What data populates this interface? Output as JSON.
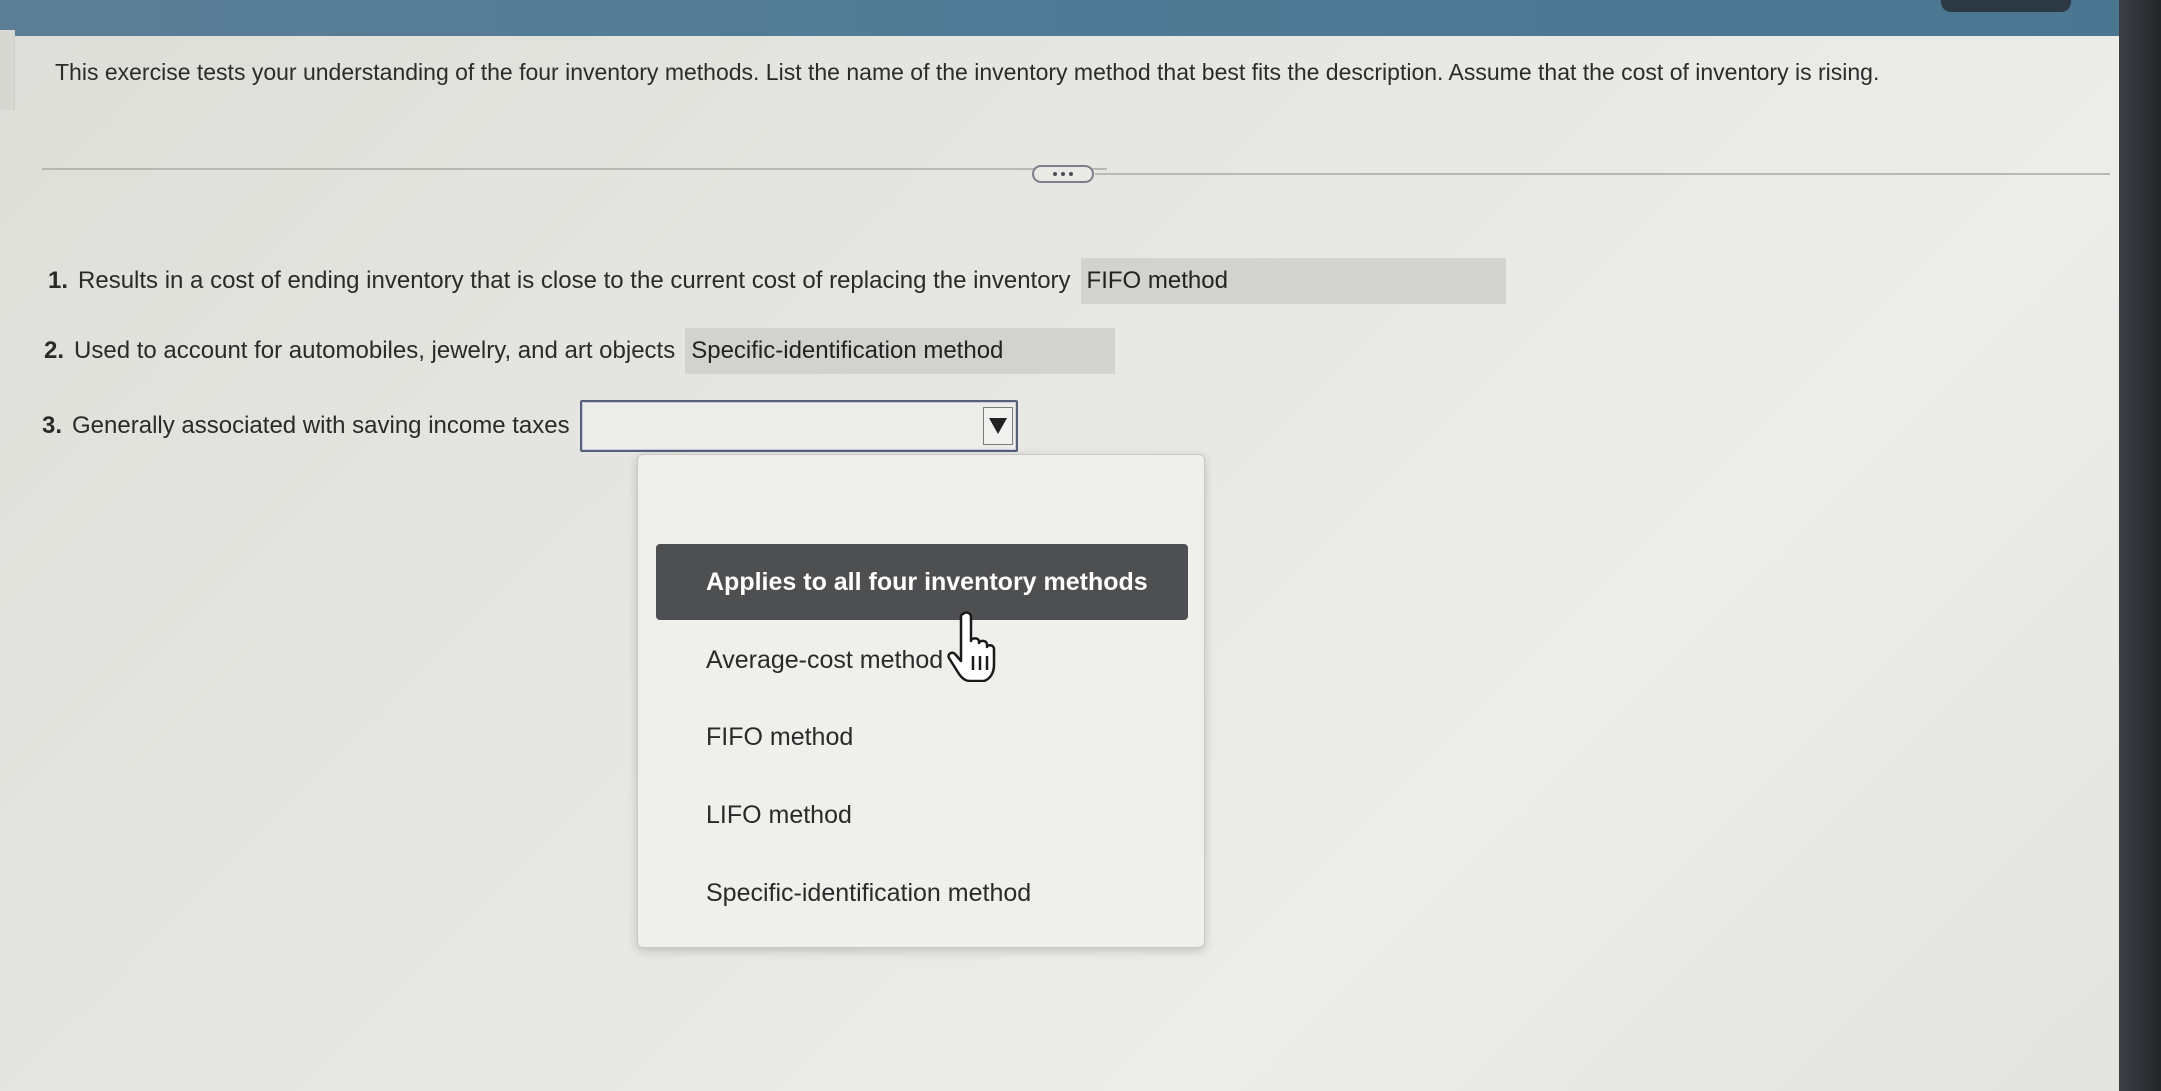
{
  "instructions": "This exercise tests your understanding of the four inventory methods. List the name of the inventory method that best fits the description. Assume that the cost of inventory is rising.",
  "questions": [
    {
      "number": "1.",
      "text": "Results in a cost of ending inventory that is close to the current cost of replacing the inventory",
      "answer": "FIFO method"
    },
    {
      "number": "2.",
      "text": "Used to account for automobiles, jewelry, and art objects",
      "answer": "Specific-identification method"
    },
    {
      "number": "3.",
      "text": "Generally associated with saving income taxes",
      "answer": ""
    }
  ],
  "dropdown": {
    "options": [
      "Applies to all four inventory methods",
      "Average-cost method",
      "FIFO method",
      "LIFO method",
      "Specific-identification method"
    ],
    "highlighted_index": 0
  },
  "colors": {
    "highlight_bg": "#4e4f51",
    "answer_bg": "#d2d2cf",
    "top_bar": "#4f7a95"
  }
}
